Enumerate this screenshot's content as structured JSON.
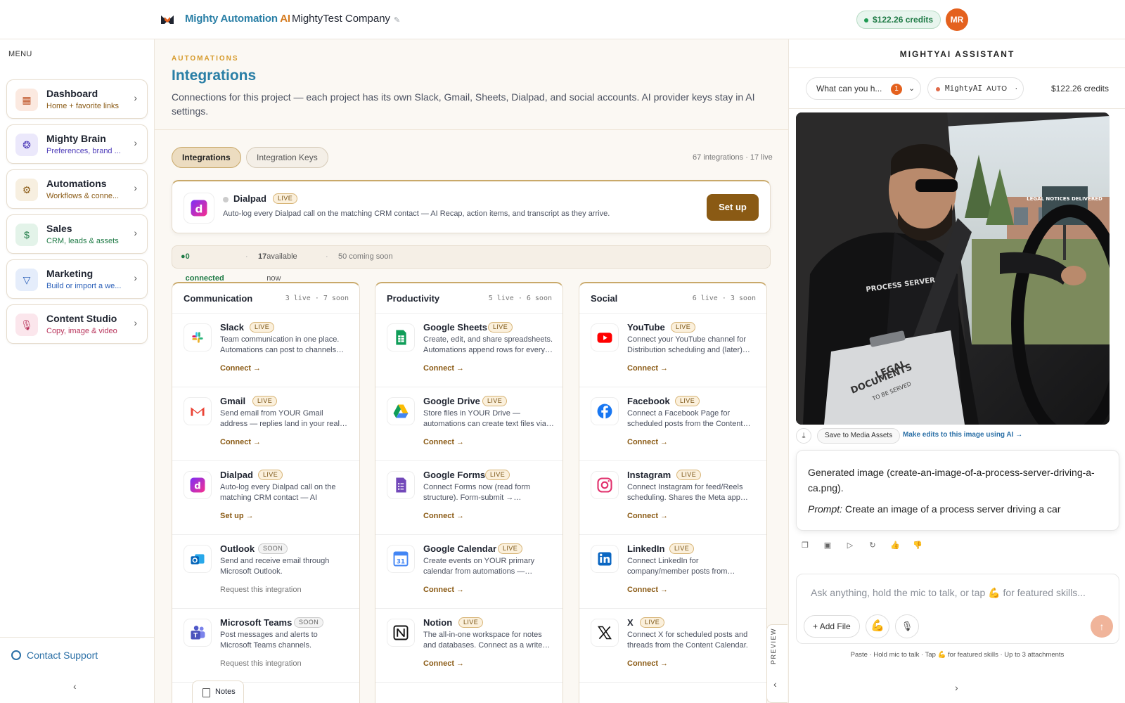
{
  "topbar": {
    "brand_main": "Mighty Automation ",
    "brand_ai": "AI",
    "company": "MightyTest Company",
    "credits": "$122.26 credits",
    "avatar": "MR",
    "colors": {
      "brand": "#2a7fa6",
      "accent": "#d4791c"
    }
  },
  "sidebar": {
    "menu_label": "MENU",
    "items": [
      {
        "title": "Dashboard",
        "subtitle": "Home + favorite links",
        "icon": "grid-icon",
        "color": "#c0562a"
      },
      {
        "title": "Mighty Brain",
        "subtitle": "Preferences, brand ...",
        "icon": "brain-icon",
        "color": "#4c3ab8"
      },
      {
        "title": "Automations",
        "subtitle": "Workflows & conne...",
        "icon": "gear-icon",
        "color": "#8a5a14"
      },
      {
        "title": "Sales",
        "subtitle": "CRM, leads & assets",
        "icon": "dollar-icon",
        "color": "#1e7a45"
      },
      {
        "title": "Marketing",
        "subtitle": "Build or import a we...",
        "icon": "funnel-icon",
        "color": "#2a5fb8"
      },
      {
        "title": "Content Studio",
        "subtitle": "Copy, image & video",
        "icon": "mic-icon",
        "color": "#b8325a"
      }
    ],
    "contact_support": "Contact Support"
  },
  "main": {
    "kicker": "AUTOMATIONS",
    "title": "Integrations",
    "description": "Connections for this project — each project has its own Slack, Gmail, Sheets, Dialpad, and social accounts. AI provider keys stay in AI settings.",
    "tabs": [
      "Integrations",
      "Integration Keys"
    ],
    "count_text": "67 integrations · 17 live",
    "featured": {
      "name": "Dialpad",
      "badge": "LIVE",
      "description": "Auto-log every Dialpad call on the matching CRM contact — AI Recap, action items, and transcript as they arrive.",
      "button": "Set up"
    },
    "status": {
      "connected": "0 connected",
      "available_num": "17",
      "available_text": " available now",
      "soon": "50 coming soon"
    },
    "columns": [
      {
        "title": "Communication",
        "counts": "3 live · 7 soon",
        "cards": [
          {
            "name": "Slack",
            "badge": "LIVE",
            "desc": "Team communication in one place. Automations can post to channels…",
            "action": "Connect →",
            "icon": "slack-icon"
          },
          {
            "name": "Gmail",
            "badge": "LIVE",
            "desc": "Send email from YOUR Gmail address — replies land in your real…",
            "action": "Connect →",
            "icon": "gmail-icon"
          },
          {
            "name": "Dialpad",
            "badge": "LIVE",
            "desc": "Auto-log every Dialpad call on the matching CRM contact — AI Recap,…",
            "action": "Set up →",
            "icon": "dialpad-icon"
          },
          {
            "name": "Outlook",
            "badge": "SOON",
            "desc": "Send and receive email through Microsoft Outlook.",
            "action": "Request this integration",
            "icon": "outlook-icon"
          },
          {
            "name": "Microsoft Teams",
            "badge": "SOON",
            "desc": "Post messages and alerts to Microsoft Teams channels.",
            "action": "Request this integration",
            "icon": "teams-icon"
          }
        ]
      },
      {
        "title": "Productivity",
        "counts": "5 live · 6 soon",
        "cards": [
          {
            "name": "Google Sheets",
            "badge": "LIVE",
            "desc": "Create, edit, and share spreadsheets. Automations append rows for every…",
            "action": "Connect →",
            "icon": "sheets-icon"
          },
          {
            "name": "Google Drive",
            "badge": "LIVE",
            "desc": "Store files in YOUR Drive — automations can create text files via…",
            "action": "Connect →",
            "icon": "drive-icon"
          },
          {
            "name": "Google Forms",
            "badge": "LIVE",
            "desc": "Connect Forms now (read form structure). Form-submit →…",
            "action": "Connect →",
            "icon": "forms-icon"
          },
          {
            "name": "Google Calendar",
            "badge": "LIVE",
            "desc": "Create events on YOUR primary calendar from automations —…",
            "action": "Connect →",
            "icon": "calendar-icon"
          },
          {
            "name": "Notion",
            "badge": "LIVE",
            "desc": "The all-in-one workspace for notes and databases. Connect as a write…",
            "action": "Connect →",
            "icon": "notion-icon"
          }
        ]
      },
      {
        "title": "Social",
        "counts": "6 live · 3 soon",
        "cards": [
          {
            "name": "YouTube",
            "badge": "LIVE",
            "desc": "Connect your YouTube channel for Distribution scheduling and (later)…",
            "action": "Connect →",
            "icon": "youtube-icon"
          },
          {
            "name": "Facebook",
            "badge": "LIVE",
            "desc": "Connect a Facebook Page for scheduled posts from the Content…",
            "action": "Connect →",
            "icon": "facebook-icon"
          },
          {
            "name": "Instagram",
            "badge": "LIVE",
            "desc": "Connect Instagram for feed/Reels scheduling. Shares the Meta app…",
            "action": "Connect →",
            "icon": "instagram-icon"
          },
          {
            "name": "LinkedIn",
            "badge": "LIVE",
            "desc": "Connect LinkedIn for company/member posts from…",
            "action": "Connect →",
            "icon": "linkedin-icon"
          },
          {
            "name": "X",
            "badge": "LIVE",
            "desc": "Connect X for scheduled posts and threads from the Content Calendar.",
            "action": "Connect →",
            "icon": "x-icon"
          }
        ]
      }
    ],
    "notes_tab": "Notes",
    "preview_tab": "PREVIEW"
  },
  "assistant": {
    "title": "MIGHTYAI ASSISTANT",
    "prompt_select": "What can you h...",
    "prompt_badge": "1",
    "model": "MightyAI",
    "model_mode": "AUTO",
    "credits": "$122.26 credits",
    "image_texts": {
      "sign": "LEGAL NOTICES DELIVERED",
      "jacket": "PROCESS SERVER",
      "clipboard_1": "LEGAL",
      "clipboard_2": "DOCUMENTS",
      "clipboard_3": "TO BE SERVED"
    },
    "save_button": "Save to Media Assets",
    "edit_link": "Make edits to this image using AI →",
    "message_line": "Generated image (create-an-image-of-a-process-server-driving-a-ca.png).",
    "prompt_label": "Prompt:",
    "prompt_text": " Create an image of a process server driving a car",
    "composer_placeholder": "Ask anything, hold the mic to talk, or tap 💪 for featured skills...",
    "add_file": "Add File",
    "hint": "Paste · Hold mic to talk · Tap 💪 for featured skills · Up to 3 attachments"
  }
}
